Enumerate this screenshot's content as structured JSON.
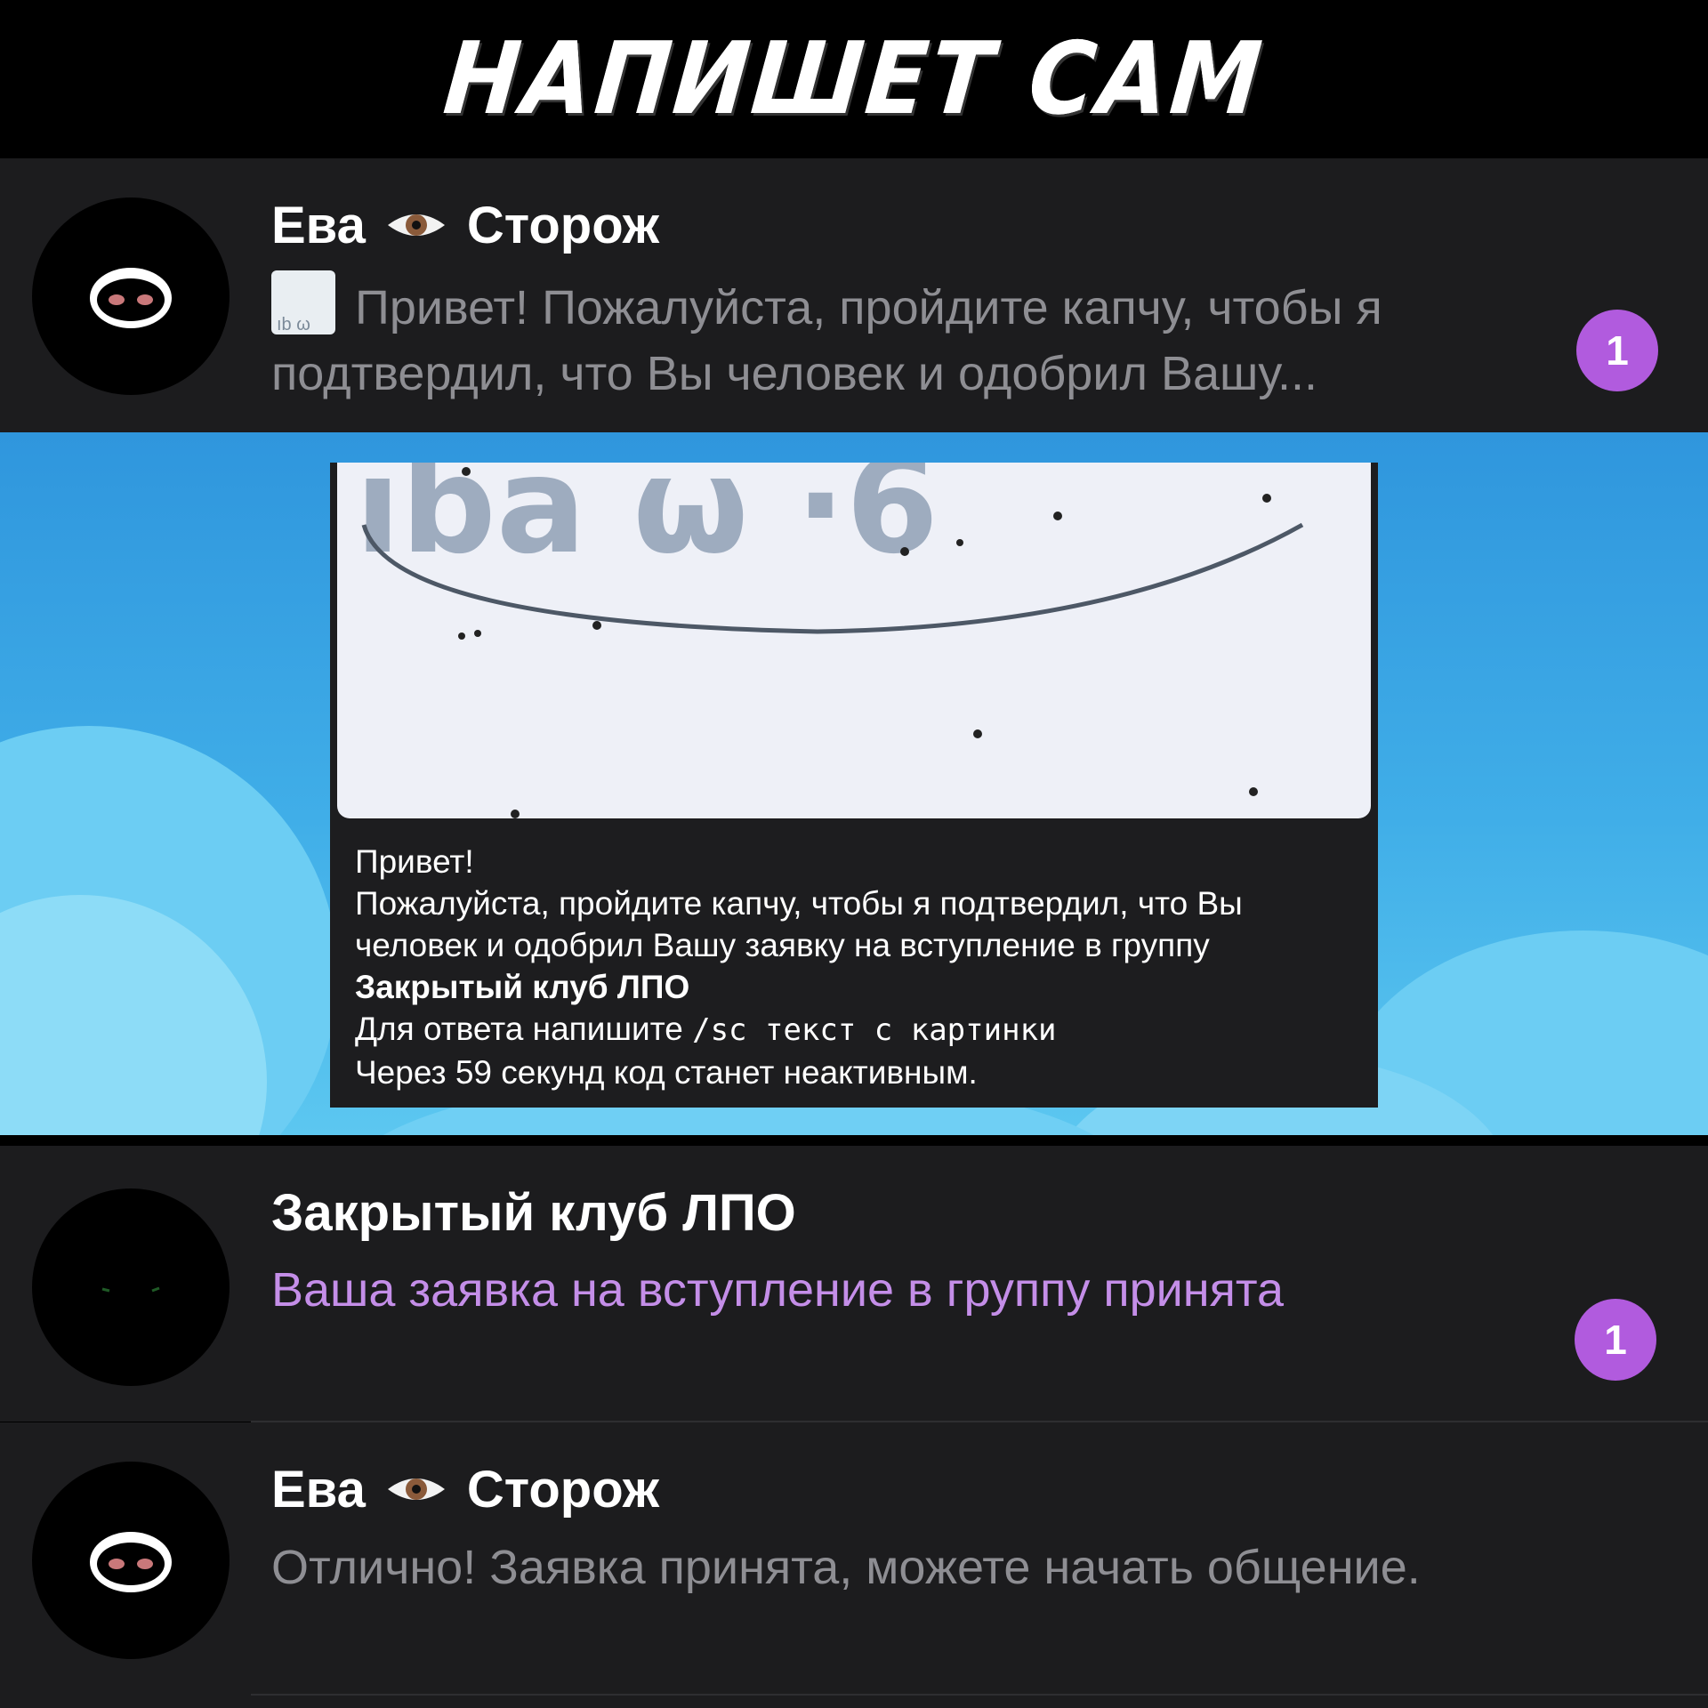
{
  "banner": {
    "title": "НАПИШЕТ САМ"
  },
  "chats": [
    {
      "name_first": "Ева",
      "name_icon": "eye-icon",
      "name_last": "Сторож",
      "preview_line1": "Привет! Пожалуйста, пройдите капчу, чтобы я",
      "preview_line2": "подтвердил, что Вы человек и одобрил Вашу...",
      "unread": "1"
    },
    {
      "name": "Закрытый клуб ЛПО",
      "preview": "Ваша заявка на вступление в группу принята",
      "unread": "1"
    },
    {
      "name_first": "Ева",
      "name_icon": "eye-icon",
      "name_last": "Сторож",
      "preview": "Отлично! Заявка принята, можете начать общение."
    }
  ],
  "message": {
    "captcha_glyphs": "ıba ω ·6",
    "line1": "Привет!",
    "line2": "Пожалуйста, пройдите капчу, чтобы я подтвердил, что Вы",
    "line3": "человек и одобрил Вашу заявку на вступление в группу",
    "group_name": "Закрытый клуб ЛПО",
    "line5_prefix": "Для ответа напишите ",
    "command": "/sc текст с картинки",
    "line6": "Через 59 секунд код станет неактивным."
  },
  "colors": {
    "accent_purple": "#b15bde",
    "preview_purple": "#c48ee8",
    "chat_background_blue": "#40aee8",
    "row_background": "#1c1c1e"
  }
}
